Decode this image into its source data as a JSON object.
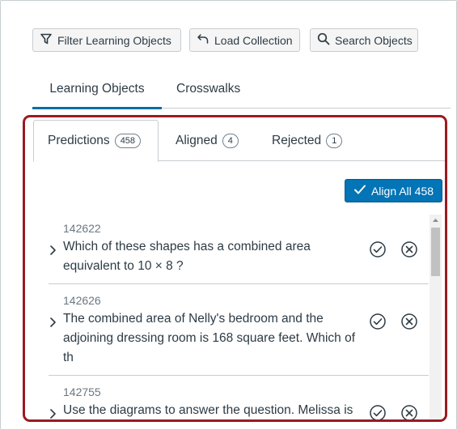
{
  "toolbar": {
    "filter_label": "Filter Learning Objects",
    "load_label": "Load Collection",
    "search_label": "Search Objects"
  },
  "main_tabs": [
    {
      "label": "Learning Objects",
      "active": true
    },
    {
      "label": "Crosswalks",
      "active": false
    }
  ],
  "sub_tabs": [
    {
      "label": "Predictions",
      "count": "458",
      "active": true
    },
    {
      "label": "Aligned",
      "count": "4",
      "active": false
    },
    {
      "label": "Rejected",
      "count": "1",
      "active": false
    }
  ],
  "align_all_label": "Align All 458",
  "items": [
    {
      "id": "142622",
      "text": "Which of these shapes has a combined area equivalent to 10 × 8 ?"
    },
    {
      "id": "142626",
      "text": "The combined area of Nelly's bedroom and the adjoining dressing room is 168 square feet. Which of th"
    },
    {
      "id": "142755",
      "text": "Use the diagrams to answer the question. Melissa is planning to build a swimming pool in her back ya"
    }
  ],
  "colors": {
    "accent": "#0374b5",
    "tab_underline": "#0770a3",
    "highlight_border": "#9b1a21",
    "text": "#2d3b45"
  }
}
